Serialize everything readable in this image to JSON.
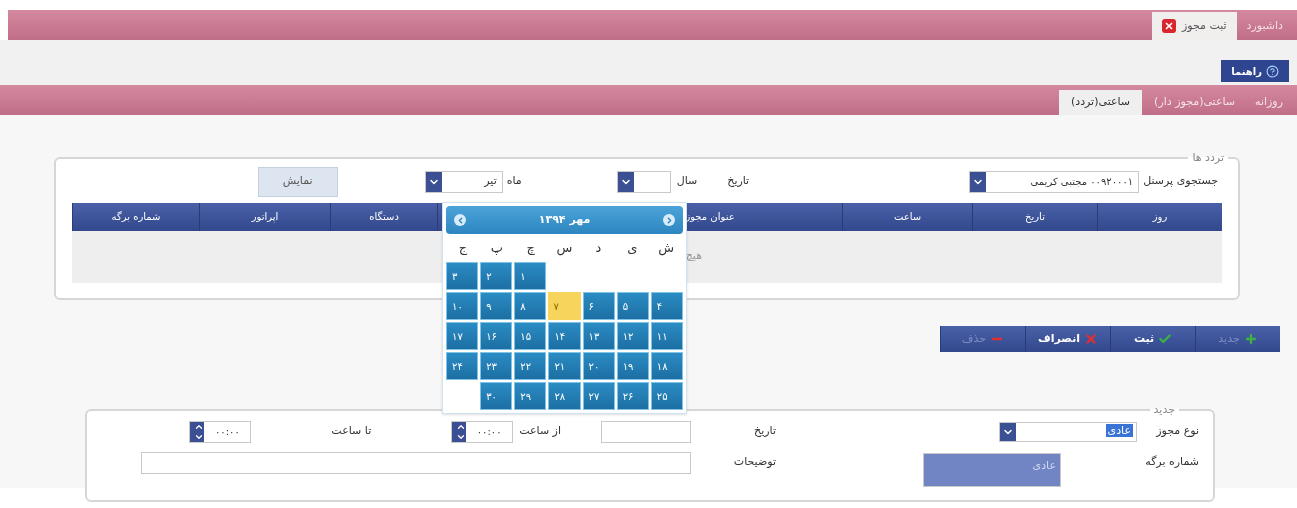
{
  "top_tabs": [
    {
      "label": "داشبورد",
      "selected": false,
      "closable": false
    },
    {
      "label": "ثبت مجوز",
      "selected": true,
      "closable": true
    }
  ],
  "help_button": "راهنما",
  "sub_tabs": [
    {
      "label": "روزانه",
      "selected": false
    },
    {
      "label": "ساعتی(مجوز دار)",
      "selected": false
    },
    {
      "label": "ساعتی(تردد)",
      "selected": true
    }
  ],
  "traffic_panel": {
    "legend": "تردد ها",
    "person_label": "جستجوی پرسنل",
    "person_value": "۰۰۹۲۰۰۰۱ مجتبی کریمی",
    "date_label": "تاریخ",
    "year_label": "سال",
    "month_label": "ماه",
    "month_value": "تیر",
    "show_button": "نمایش",
    "table": {
      "columns": [
        "روز",
        "تاریخ",
        "ساعت",
        "عنوان مجوز",
        "دستگاه",
        "اپراتور",
        "شماره برگه"
      ],
      "empty_text": "هیچ"
    }
  },
  "toolbar": [
    {
      "label": "جدید",
      "kind": "add",
      "disabled": true
    },
    {
      "label": "ثبت",
      "kind": "save",
      "disabled": false
    },
    {
      "label": "انصراف",
      "kind": "cancel",
      "disabled": false
    },
    {
      "label": "حذف",
      "kind": "delete",
      "disabled": true
    }
  ],
  "new_panel": {
    "legend": "جدید",
    "permit_type_label": "نوع مجوز",
    "permit_type_value": "عادی",
    "permit_type_options": [
      {
        "label": "عادی",
        "selected": true
      }
    ],
    "sheet_label": "شماره برگه",
    "date_label": "تاریخ",
    "from_label": "از ساعت",
    "from_value": "۰۰:۰۰",
    "to_label": "تا ساعت",
    "to_value": "۰۰:۰۰",
    "description_label": "توضیحات"
  },
  "calendar": {
    "title": "مهر ۱۳۹۴",
    "weekdays": [
      "ش",
      "ی",
      "د",
      "س",
      "چ",
      "پ",
      "ج"
    ],
    "weeks": [
      [
        {
          "label": "۱",
          "selected": false
        },
        {
          "label": "۲",
          "selected": false
        },
        {
          "label": "۳",
          "selected": false
        }
      ],
      [
        {
          "label": "۴",
          "selected": false
        },
        {
          "label": "۵",
          "selected": false
        },
        {
          "label": "۶",
          "selected": false
        },
        {
          "label": "۷",
          "selected": true
        },
        {
          "label": "۸",
          "selected": false
        },
        {
          "label": "۹",
          "selected": false
        },
        {
          "label": "۱۰",
          "selected": false
        }
      ],
      [
        {
          "label": "۱۱",
          "selected": false
        },
        {
          "label": "۱۲",
          "selected": false
        },
        {
          "label": "۱۳",
          "selected": false
        },
        {
          "label": "۱۴",
          "selected": false
        },
        {
          "label": "۱۵",
          "selected": false
        },
        {
          "label": "۱۶",
          "selected": false
        },
        {
          "label": "۱۷",
          "selected": false
        }
      ],
      [
        {
          "label": "۱۸",
          "selected": false
        },
        {
          "label": "۱۹",
          "selected": false
        },
        {
          "label": "۲۰",
          "selected": false
        },
        {
          "label": "۲۱",
          "selected": false
        },
        {
          "label": "۲۲",
          "selected": false
        },
        {
          "label": "۲۳",
          "selected": false
        },
        {
          "label": "۲۴",
          "selected": false
        }
      ],
      [
        {
          "label": "۲۵",
          "selected": false
        },
        {
          "label": "۲۶",
          "selected": false
        },
        {
          "label": "۲۷",
          "selected": false
        },
        {
          "label": "۲۸",
          "selected": false
        },
        {
          "label": "۲۹",
          "selected": false
        },
        {
          "label": "۳۰",
          "selected": false
        }
      ]
    ]
  }
}
